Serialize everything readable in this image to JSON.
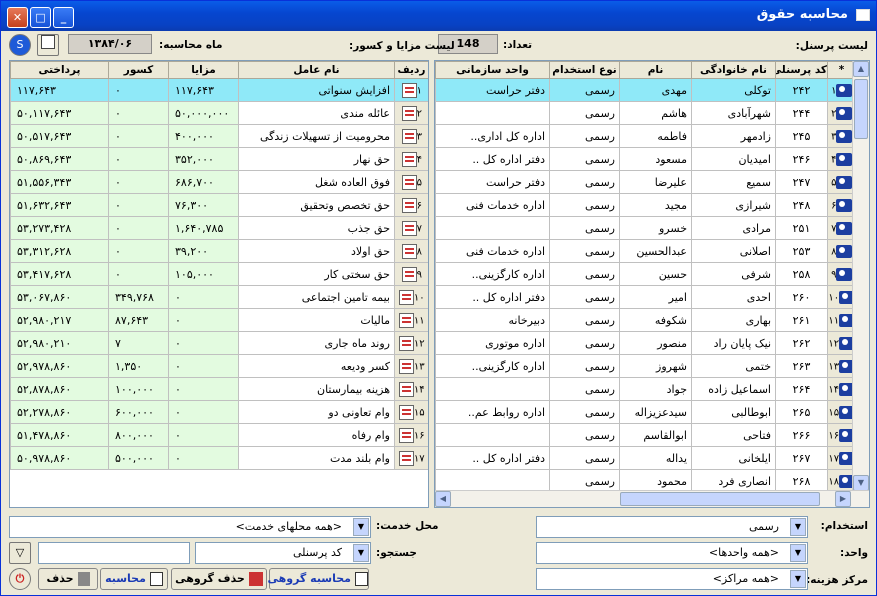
{
  "window": {
    "title": "محاسبه حقوق"
  },
  "header": {
    "personnel_list_label": "لیست پرسنل:",
    "count_label": "تعداد:",
    "count_value": "148",
    "benefits_label": "لیست مزایا و کسور:",
    "month_label": "ماه محاسبه:",
    "month_value": "۱۳۸۴/۰۶"
  },
  "personnel": {
    "columns": [
      "*",
      "کد پرسنلی",
      "نام خانوادگی",
      "نام",
      "نوع استخدام",
      "واحد سازمانی"
    ],
    "rows": [
      {
        "idx": "۱",
        "code": "۲۴۲",
        "last": "توکلی",
        "first": "مهدی",
        "type": "رسمی",
        "unit": "دفتر حراست"
      },
      {
        "idx": "۲",
        "code": "۲۴۴",
        "last": "شهرآبادی",
        "first": "هاشم",
        "type": "رسمی",
        "unit": ""
      },
      {
        "idx": "۳",
        "code": "۲۴۵",
        "last": "زادمهر",
        "first": "فاطمه",
        "type": "رسمی",
        "unit": "اداره کل اداری.."
      },
      {
        "idx": "۴",
        "code": "۲۴۶",
        "last": "امیدیان",
        "first": "مسعود",
        "type": "رسمی",
        "unit": "دفتر اداره کل .."
      },
      {
        "idx": "۵",
        "code": "۲۴۷",
        "last": "سمیع",
        "first": "علیرضا",
        "type": "رسمی",
        "unit": "دفتر حراست"
      },
      {
        "idx": "۶",
        "code": "۲۴۸",
        "last": "شیرازی",
        "first": "مجید",
        "type": "رسمی",
        "unit": "اداره خدمات فنی"
      },
      {
        "idx": "۷",
        "code": "۲۵۱",
        "last": "مرادی",
        "first": "خسرو",
        "type": "رسمی",
        "unit": ""
      },
      {
        "idx": "۸",
        "code": "۲۵۳",
        "last": "اصلانی",
        "first": "عبدالحسین",
        "type": "رسمی",
        "unit": "اداره خدمات فنی"
      },
      {
        "idx": "۹",
        "code": "۲۵۸",
        "last": "شرفی",
        "first": "حسین",
        "type": "رسمی",
        "unit": "اداره کارگزینی.."
      },
      {
        "idx": "۱۰",
        "code": "۲۶۰",
        "last": "احدی",
        "first": "امیر",
        "type": "رسمی",
        "unit": "دفتر اداره کل .."
      },
      {
        "idx": "۱۱",
        "code": "۲۶۱",
        "last": "بهاری",
        "first": "شکوفه",
        "type": "رسمی",
        "unit": "دبیرخانه"
      },
      {
        "idx": "۱۲",
        "code": "۲۶۲",
        "last": "نیک پایان راد",
        "first": "منصور",
        "type": "رسمی",
        "unit": "اداره موتوری"
      },
      {
        "idx": "۱۳",
        "code": "۲۶۳",
        "last": "ختمی",
        "first": "شهروز",
        "type": "رسمی",
        "unit": "اداره کارگزینی.."
      },
      {
        "idx": "۱۴",
        "code": "۲۶۴",
        "last": "اسماعیل زاده",
        "first": "جواد",
        "type": "رسمی",
        "unit": ""
      },
      {
        "idx": "۱۵",
        "code": "۲۶۵",
        "last": "ابوطالبی",
        "first": "سیدعزیزاله",
        "type": "رسمی",
        "unit": "اداره روابط عم.."
      },
      {
        "idx": "۱۶",
        "code": "۲۶۶",
        "last": "فتاحی",
        "first": "ابوالقاسم",
        "type": "رسمی",
        "unit": ""
      },
      {
        "idx": "۱۷",
        "code": "۲۶۷",
        "last": "ایلخانی",
        "first": "یداله",
        "type": "رسمی",
        "unit": "دفتر اداره کل .."
      },
      {
        "idx": "۱۸",
        "code": "۲۶۸",
        "last": "انصاری فرد",
        "first": "محمود",
        "type": "رسمی",
        "unit": ""
      }
    ]
  },
  "items": {
    "columns": [
      "ردیف",
      "نام عامل",
      "مزایا",
      "کسور",
      "پرداختی"
    ],
    "rows": [
      {
        "idx": "۱",
        "name": "افزایش سنواتی",
        "benefit": "۱۱۷,۶۴۳",
        "deduct": "۰",
        "paid": "۱۱۷,۶۴۳"
      },
      {
        "idx": "۲",
        "name": "عائله مندی",
        "benefit": "۵۰,۰۰۰,۰۰۰",
        "deduct": "۰",
        "paid": "۵۰,۱۱۷,۶۴۳"
      },
      {
        "idx": "۳",
        "name": "محرومیت از تسهیلات زندگی",
        "benefit": "۴۰۰,۰۰۰",
        "deduct": "۰",
        "paid": "۵۰,۵۱۷,۶۴۳"
      },
      {
        "idx": "۴",
        "name": "حق نهار",
        "benefit": "۳۵۲,۰۰۰",
        "deduct": "۰",
        "paid": "۵۰,۸۶۹,۶۴۳"
      },
      {
        "idx": "۵",
        "name": "فوق العاده شغل",
        "benefit": "۶۸۶,۷۰۰",
        "deduct": "۰",
        "paid": "۵۱,۵۵۶,۳۴۳"
      },
      {
        "idx": "۶",
        "name": "حق تخصص وتحقیق",
        "benefit": "۷۶,۳۰۰",
        "deduct": "۰",
        "paid": "۵۱,۶۳۲,۶۴۳"
      },
      {
        "idx": "۷",
        "name": "حق جذب",
        "benefit": "۱,۶۴۰,۷۸۵",
        "deduct": "۰",
        "paid": "۵۳,۲۷۳,۴۲۸"
      },
      {
        "idx": "۸",
        "name": "حق اولاد",
        "benefit": "۳۹,۲۰۰",
        "deduct": "۰",
        "paid": "۵۳,۳۱۲,۶۲۸"
      },
      {
        "idx": "۹",
        "name": "حق سختی کار",
        "benefit": "۱۰۵,۰۰۰",
        "deduct": "۰",
        "paid": "۵۳,۴۱۷,۶۲۸"
      },
      {
        "idx": "۱۰",
        "name": "بیمه تامین اجتماعی",
        "benefit": "۰",
        "deduct": "۳۴۹,۷۶۸",
        "paid": "۵۳,۰۶۷,۸۶۰"
      },
      {
        "idx": "۱۱",
        "name": "مالیات",
        "benefit": "۰",
        "deduct": "۸۷,۶۴۳",
        "paid": "۵۲,۹۸۰,۲۱۷"
      },
      {
        "idx": "۱۲",
        "name": "روند ماه جاری",
        "benefit": "۰",
        "deduct": "۷",
        "paid": "۵۲,۹۸۰,۲۱۰"
      },
      {
        "idx": "۱۳",
        "name": "کسر ودیعه",
        "benefit": "۰",
        "deduct": "۱,۳۵۰",
        "paid": "۵۲,۹۷۸,۸۶۰"
      },
      {
        "idx": "۱۴",
        "name": "هزینه بیمارستان",
        "benefit": "۰",
        "deduct": "۱۰۰,۰۰۰",
        "paid": "۵۲,۸۷۸,۸۶۰"
      },
      {
        "idx": "۱۵",
        "name": "وام تعاونی دو",
        "benefit": "۰",
        "deduct": "۶۰۰,۰۰۰",
        "paid": "۵۲,۲۷۸,۸۶۰"
      },
      {
        "idx": "۱۶",
        "name": "وام رفاه",
        "benefit": "۰",
        "deduct": "۸۰۰,۰۰۰",
        "paid": "۵۱,۴۷۸,۸۶۰"
      },
      {
        "idx": "۱۷",
        "name": "وام بلند مدت",
        "benefit": "۰",
        "deduct": "۵۰۰,۰۰۰",
        "paid": "۵۰,۹۷۸,۸۶۰"
      }
    ]
  },
  "filters": {
    "employment_label": "استخدام:",
    "employment_value": "رسمی",
    "unit_label": "واحد:",
    "unit_value": "<همه واحدها>",
    "cost_center_label": "مرکز هزینه:",
    "cost_center_value": "<همه مراکز>",
    "service_place_label": "محل خدمت:",
    "service_place_value": "<همه محلهای خدمت>",
    "search_label": "جستجو:",
    "search_field_value": "کد پرسنلی",
    "search_text": ""
  },
  "actions": {
    "group_calc": "محاسبه گروهی",
    "group_delete": "حذف گروهی",
    "calc": "محاسبه",
    "delete": "حذف"
  }
}
